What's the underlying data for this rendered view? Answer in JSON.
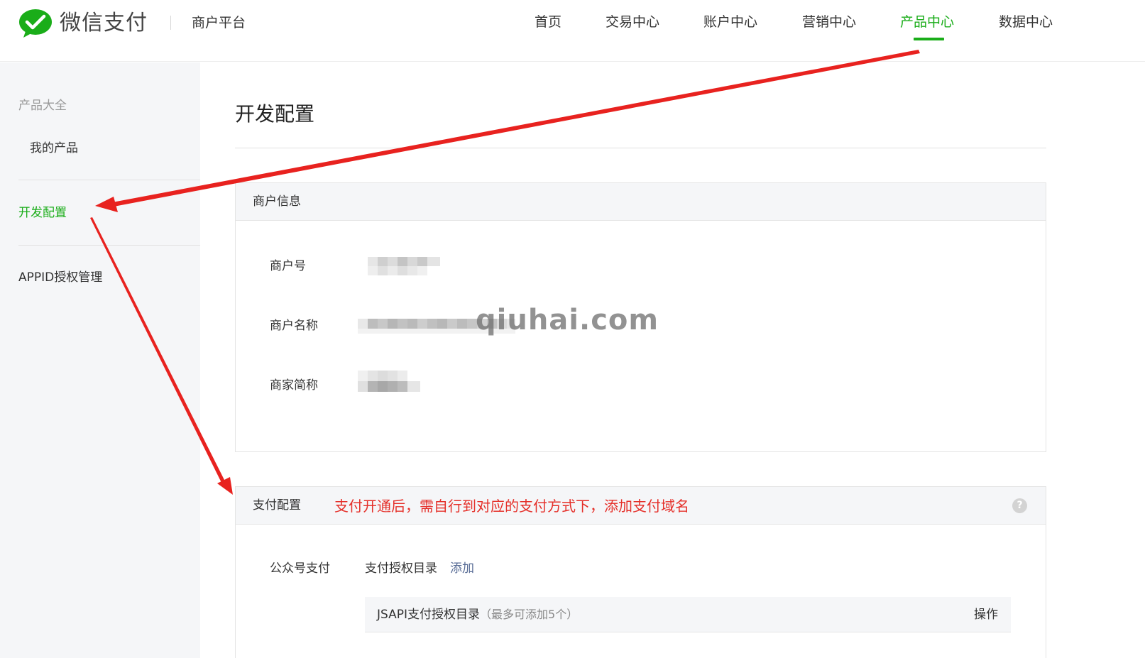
{
  "header": {
    "brand": "微信支付",
    "platform": "商户平台",
    "nav": [
      {
        "label": "首页"
      },
      {
        "label": "交易中心"
      },
      {
        "label": "账户中心"
      },
      {
        "label": "营销中心"
      },
      {
        "label": "产品中心"
      },
      {
        "label": "数据中心"
      }
    ],
    "active_nav": "产品中心"
  },
  "sidebar": {
    "group_title": "产品大全",
    "items": [
      {
        "label": "我的产品"
      },
      {
        "label": "开发配置"
      },
      {
        "label": "APPID授权管理"
      }
    ],
    "active_item": "开发配置"
  },
  "main": {
    "title": "开发配置",
    "merchant_info": {
      "title": "商户信息",
      "fields": [
        {
          "label": "商户号"
        },
        {
          "label": "商户名称"
        },
        {
          "label": "商家简称"
        }
      ]
    },
    "payment_config": {
      "title": "支付配置",
      "annotation": "支付开通后，需自行到对应的支付方式下，添加支付域名",
      "help_icon": "question-circle-icon",
      "method": "公众号支付",
      "directory_label": "支付授权目录",
      "add_link": "添加",
      "table": {
        "title": "JSAPI支付授权目录",
        "note": "（最多可添加5个）",
        "action_header": "操作"
      }
    }
  },
  "watermark": "qiuhai.com",
  "colors": {
    "brand_green": "#1aad19",
    "link_blue": "#576b95",
    "annotation_red": "#e5302a"
  }
}
